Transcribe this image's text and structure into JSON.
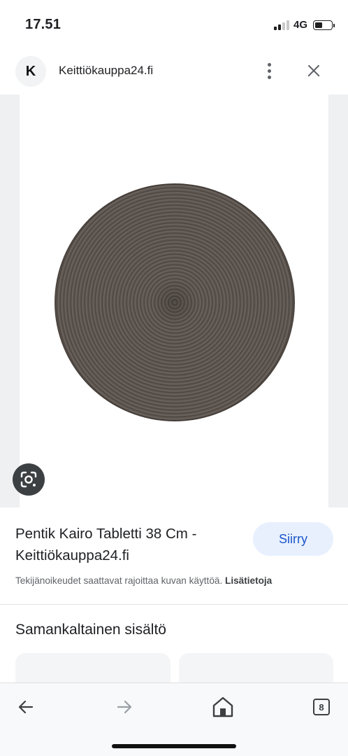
{
  "status_bar": {
    "time": "17.51",
    "network": "4G",
    "signal_bars": 2,
    "signal_bars_total": 4,
    "battery_level": 0.45
  },
  "header": {
    "site_badge_letter": "K",
    "site_domain": "Keittiökauppa24.fi",
    "more_icon": "more-vert-icon",
    "close_icon": "close-icon"
  },
  "image": {
    "lens_icon": "google-lens-icon",
    "colors": {
      "placemat": "#5a534d",
      "backdrop": "#eef0f2"
    }
  },
  "result": {
    "title": "Pentik Kairo Tabletti 38 Cm - Keittiökauppa24.fi",
    "visit_label": "Siirry",
    "copyright_text": "Tekijänoikeudet saattavat rajoittaa kuvan käyttöä.",
    "learn_more": "Lisätietoja"
  },
  "similar": {
    "heading": "Samankaltainen sisältö"
  },
  "bottom_nav": {
    "back_icon": "arrow-left-icon",
    "forward_icon": "arrow-right-icon",
    "home_icon": "home-icon",
    "tab_count": "8"
  },
  "colors": {
    "accent": "#1a56c9",
    "visit_button_bg": "#e8f0fe"
  }
}
